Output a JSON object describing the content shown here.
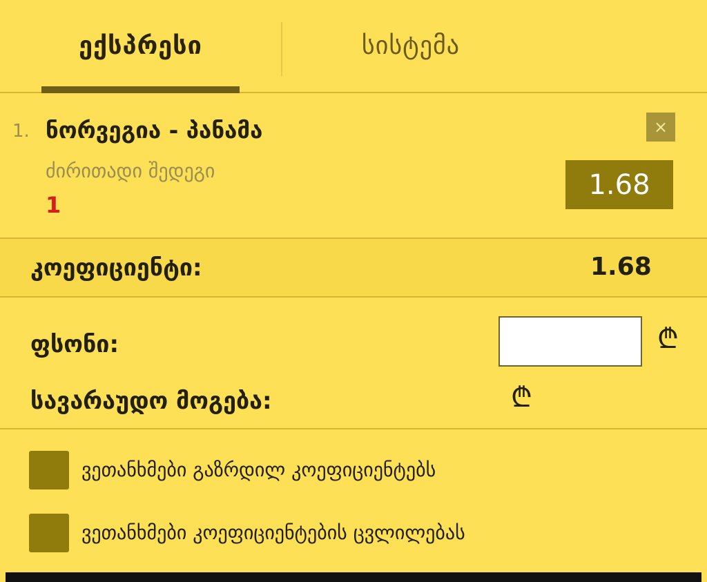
{
  "tabs": [
    {
      "label": "ექსპრესი",
      "active": true
    },
    {
      "label": "სისტემა",
      "active": false
    }
  ],
  "bet": {
    "index": "1.",
    "match": "ნორვეგია - პანამა",
    "market": "ძირითადი შედეგი",
    "selection": "1",
    "odds": "1.68",
    "remove_icon": "×"
  },
  "summary": {
    "coefficient_label": "კოეფიციენტი:",
    "coefficient_value": "1.68"
  },
  "stake": {
    "label": "ფსონი:",
    "value": "",
    "currency": "₾",
    "possible_win_label": "სავარაუდო მოგება:"
  },
  "options": [
    {
      "label": "ვეთანხმები გაზრდილ კოეფიციენტებს",
      "checked": true
    },
    {
      "label": "ვეთანხმები კოეფიციენტების ცვლილებას",
      "checked": true
    }
  ],
  "colors": {
    "background": "#fde055",
    "accent_dark": "#8f7c0c",
    "selection_red": "#d61e1e"
  }
}
